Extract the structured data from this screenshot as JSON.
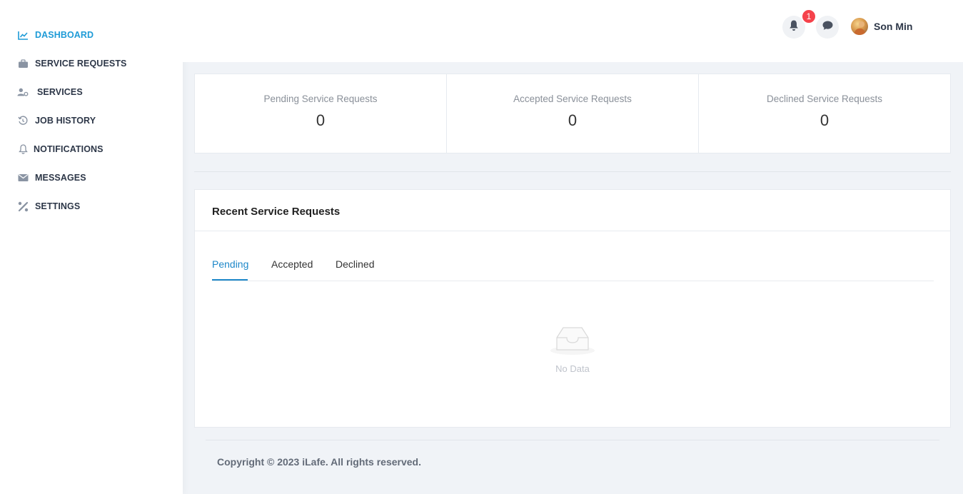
{
  "sidebar": {
    "items": [
      {
        "label": "DASHBOARD",
        "icon": "chart-line-icon",
        "active": true
      },
      {
        "label": "SERVICE REQUESTS",
        "icon": "briefcase-icon"
      },
      {
        "label": "SERVICES",
        "icon": "user-gear-icon"
      },
      {
        "label": "JOB HISTORY",
        "icon": "history-icon"
      },
      {
        "label": "NOTIFICATIONS",
        "icon": "bell-icon"
      },
      {
        "label": "MESSAGES",
        "icon": "envelope-icon"
      },
      {
        "label": "SETTINGS",
        "icon": "tools-icon"
      }
    ]
  },
  "header": {
    "notification_count": "1",
    "user_name": "Son Min"
  },
  "stats": [
    {
      "label": "Pending Service Requests",
      "value": "0"
    },
    {
      "label": "Accepted Service Requests",
      "value": "0"
    },
    {
      "label": "Declined Service Requests",
      "value": "0"
    }
  ],
  "recent": {
    "title": "Recent Service Requests",
    "tabs": [
      {
        "label": "Pending",
        "active": true
      },
      {
        "label": "Accepted"
      },
      {
        "label": "Declined"
      }
    ],
    "empty_text": "No Data"
  },
  "footer": {
    "copyright": "Copyright © 2023 iLafe. All rights reserved."
  },
  "colors": {
    "accent": "#1e9bd7",
    "badge": "#f5424b",
    "background": "#f0f3f7"
  }
}
